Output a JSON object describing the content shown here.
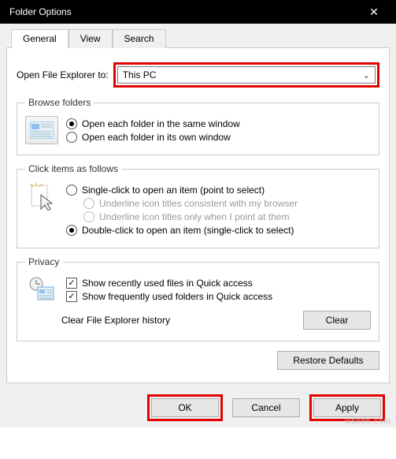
{
  "titlebar": {
    "title": "Folder Options"
  },
  "tabs": {
    "general": "General",
    "view": "View",
    "search": "Search"
  },
  "explorer": {
    "label": "Open File Explorer to:",
    "selected": "This PC"
  },
  "browse": {
    "legend": "Browse folders",
    "same_window": "Open each folder in the same window",
    "own_window": "Open each folder in its own window"
  },
  "click": {
    "legend": "Click items as follows",
    "single": "Single-click to open an item (point to select)",
    "underline_browser": "Underline icon titles consistent with my browser",
    "underline_point": "Underline icon titles only when I point at them",
    "double": "Double-click to open an item (single-click to select)"
  },
  "privacy": {
    "legend": "Privacy",
    "recent_files": "Show recently used files in Quick access",
    "freq_folders": "Show frequently used folders in Quick access",
    "clear_label": "Clear File Explorer history",
    "clear_btn": "Clear"
  },
  "buttons": {
    "restore": "Restore Defaults",
    "ok": "OK",
    "cancel": "Cancel",
    "apply": "Apply"
  },
  "watermark": "wsxdn.com"
}
